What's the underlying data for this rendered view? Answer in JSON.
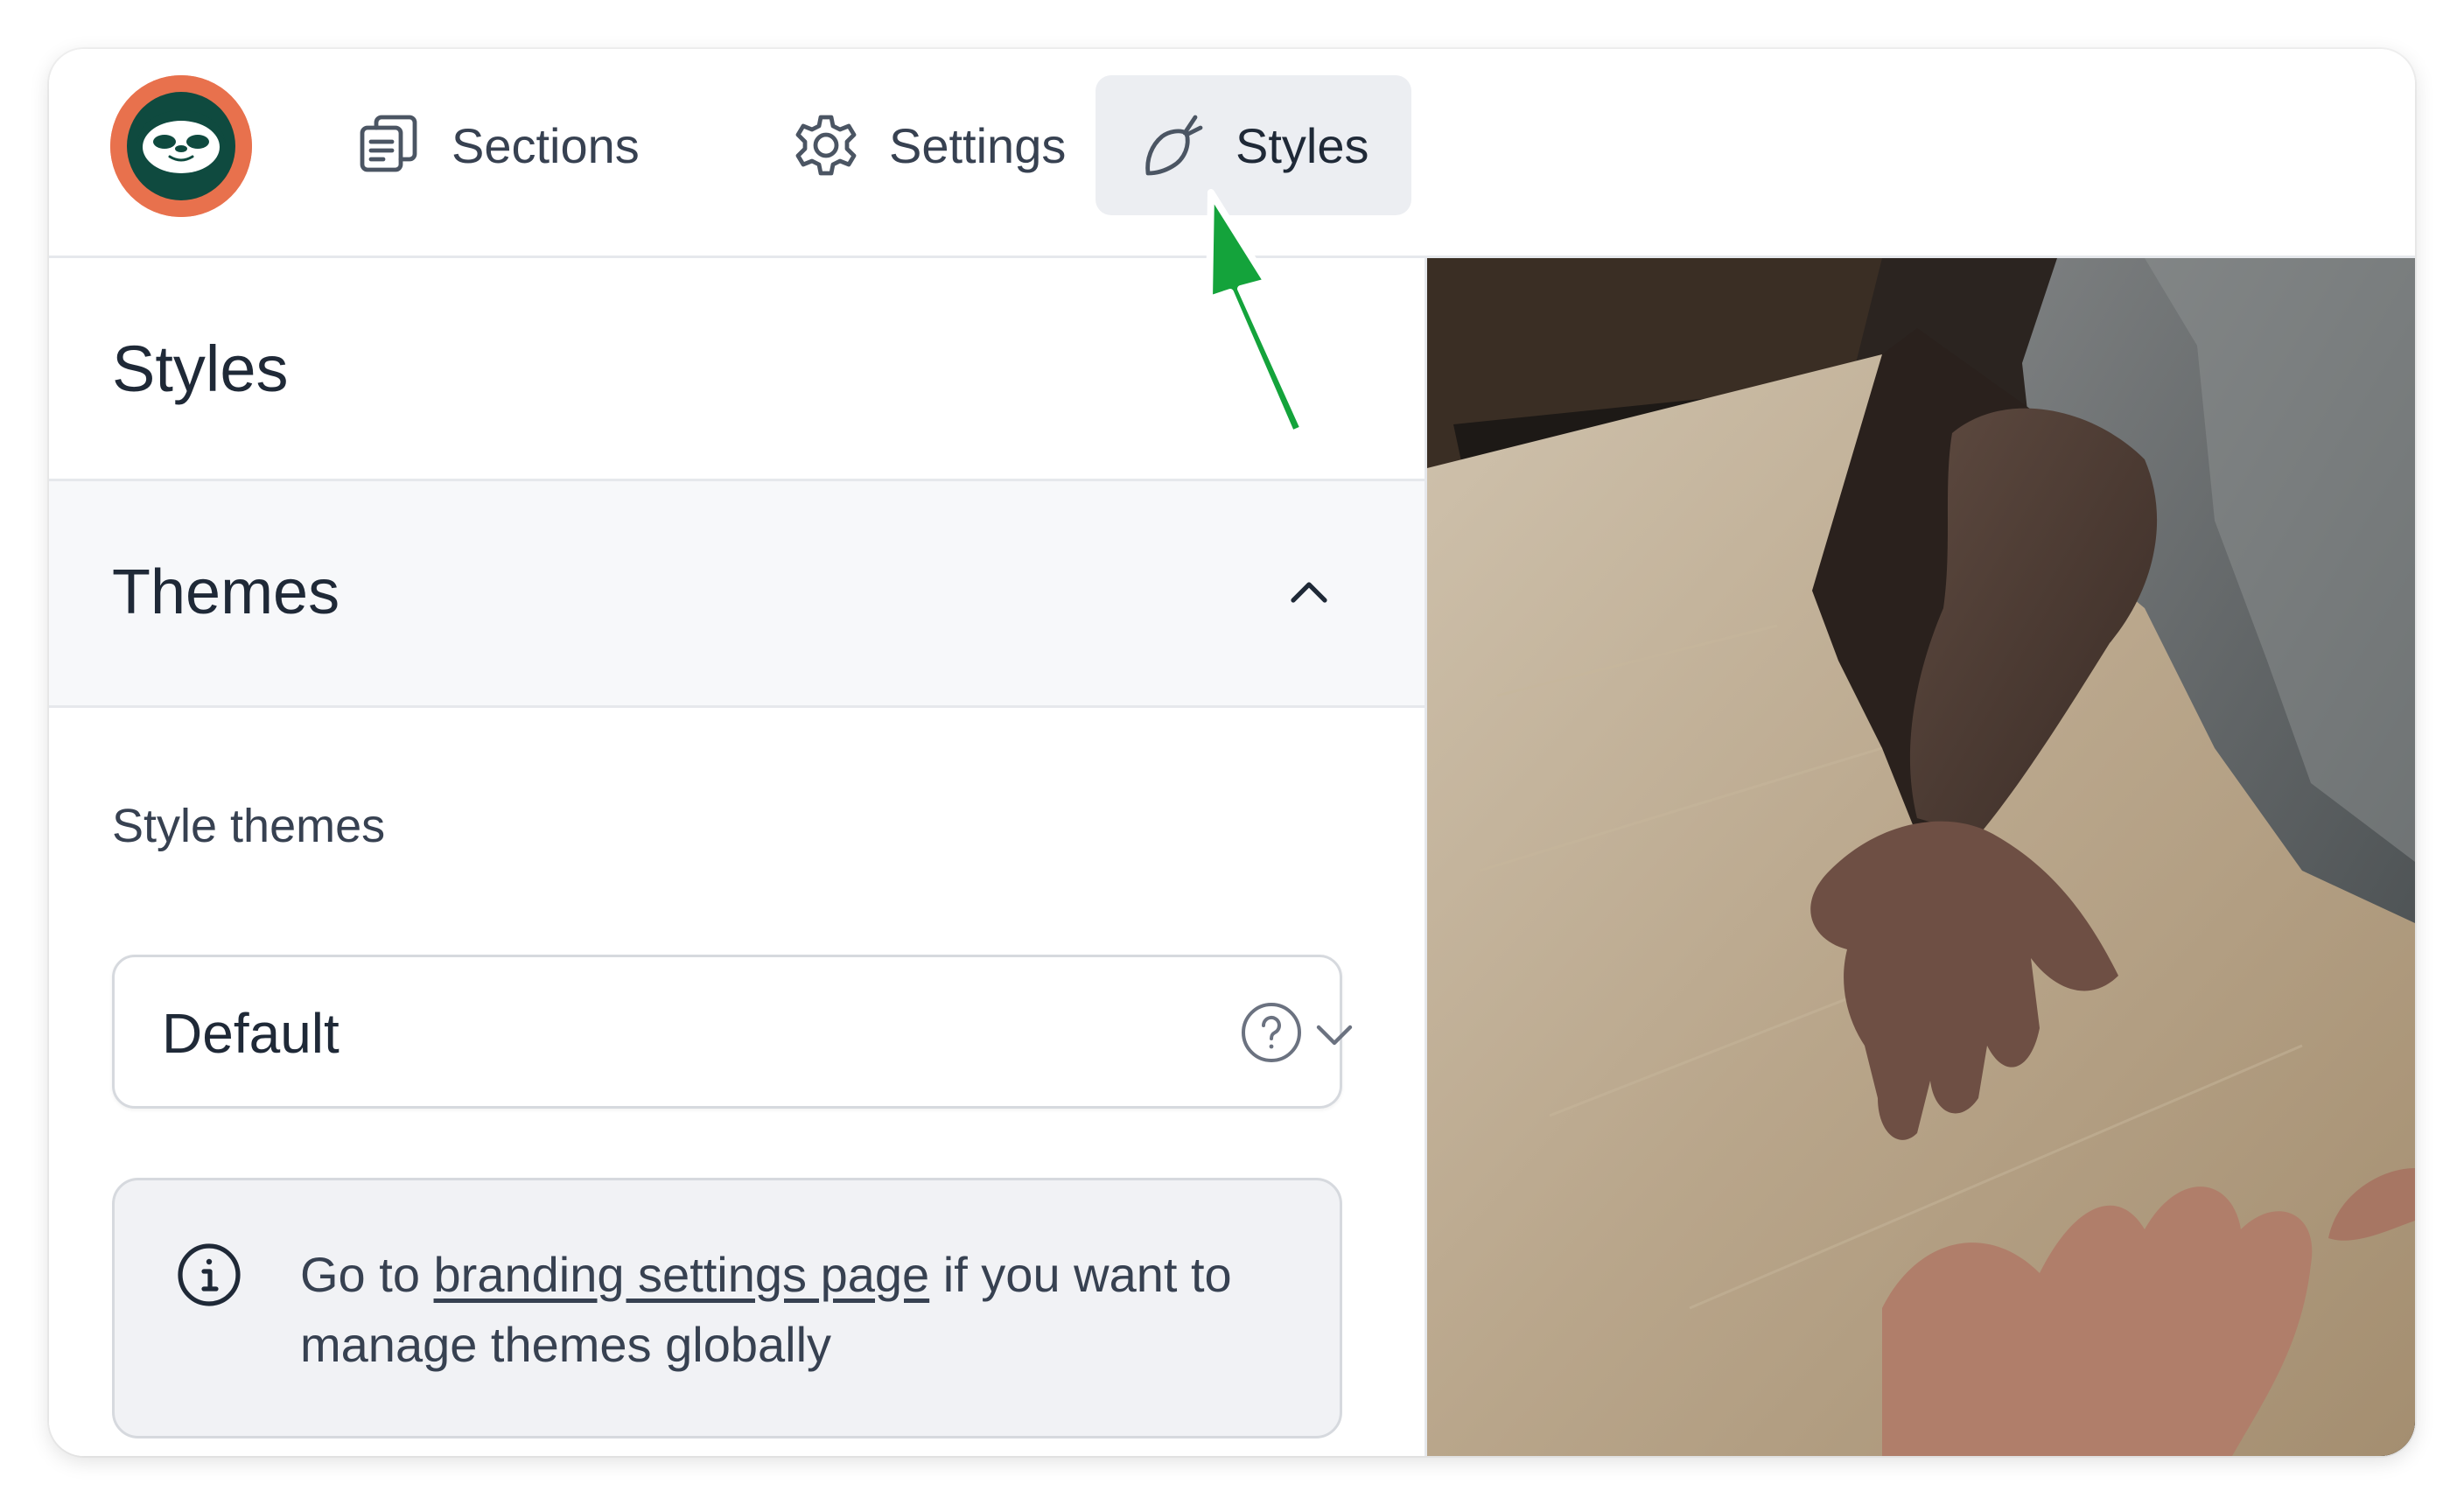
{
  "nav": {
    "items": [
      {
        "label": "Sections",
        "icon": "sections-icon",
        "active": false
      },
      {
        "label": "Settings",
        "icon": "gear-icon",
        "active": false
      },
      {
        "label": "Styles",
        "icon": "brush-icon",
        "active": true
      }
    ]
  },
  "panel": {
    "title": "Styles",
    "themes": {
      "title": "Themes",
      "expanded": true
    },
    "style_themes": {
      "label": "Style themes",
      "value": "Default"
    },
    "info": {
      "text_before": "Go to ",
      "link_text": "branding settings page",
      "text_after": " if you want to manage themes globally"
    }
  },
  "colors": {
    "logo_ring": "#e8714d",
    "logo_inner": "#0f4a3f",
    "active_tab_bg": "#eceef2",
    "annotation_arrow": "#14a33b"
  }
}
